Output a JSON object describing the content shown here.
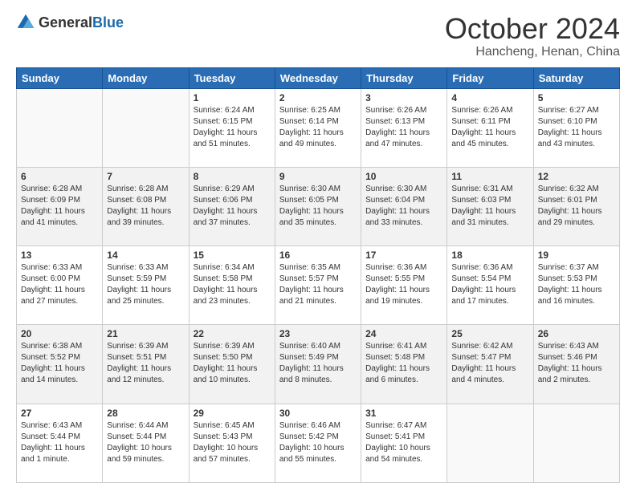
{
  "header": {
    "logo": {
      "general": "General",
      "blue": "Blue"
    },
    "title": "October 2024",
    "location": "Hancheng, Henan, China"
  },
  "weekdays": [
    "Sunday",
    "Monday",
    "Tuesday",
    "Wednesday",
    "Thursday",
    "Friday",
    "Saturday"
  ],
  "weeks": [
    [
      {
        "day": "",
        "sunrise": "",
        "sunset": "",
        "daylight": ""
      },
      {
        "day": "",
        "sunrise": "",
        "sunset": "",
        "daylight": ""
      },
      {
        "day": "1",
        "sunrise": "Sunrise: 6:24 AM",
        "sunset": "Sunset: 6:15 PM",
        "daylight": "Daylight: 11 hours and 51 minutes."
      },
      {
        "day": "2",
        "sunrise": "Sunrise: 6:25 AM",
        "sunset": "Sunset: 6:14 PM",
        "daylight": "Daylight: 11 hours and 49 minutes."
      },
      {
        "day": "3",
        "sunrise": "Sunrise: 6:26 AM",
        "sunset": "Sunset: 6:13 PM",
        "daylight": "Daylight: 11 hours and 47 minutes."
      },
      {
        "day": "4",
        "sunrise": "Sunrise: 6:26 AM",
        "sunset": "Sunset: 6:11 PM",
        "daylight": "Daylight: 11 hours and 45 minutes."
      },
      {
        "day": "5",
        "sunrise": "Sunrise: 6:27 AM",
        "sunset": "Sunset: 6:10 PM",
        "daylight": "Daylight: 11 hours and 43 minutes."
      }
    ],
    [
      {
        "day": "6",
        "sunrise": "Sunrise: 6:28 AM",
        "sunset": "Sunset: 6:09 PM",
        "daylight": "Daylight: 11 hours and 41 minutes."
      },
      {
        "day": "7",
        "sunrise": "Sunrise: 6:28 AM",
        "sunset": "Sunset: 6:08 PM",
        "daylight": "Daylight: 11 hours and 39 minutes."
      },
      {
        "day": "8",
        "sunrise": "Sunrise: 6:29 AM",
        "sunset": "Sunset: 6:06 PM",
        "daylight": "Daylight: 11 hours and 37 minutes."
      },
      {
        "day": "9",
        "sunrise": "Sunrise: 6:30 AM",
        "sunset": "Sunset: 6:05 PM",
        "daylight": "Daylight: 11 hours and 35 minutes."
      },
      {
        "day": "10",
        "sunrise": "Sunrise: 6:30 AM",
        "sunset": "Sunset: 6:04 PM",
        "daylight": "Daylight: 11 hours and 33 minutes."
      },
      {
        "day": "11",
        "sunrise": "Sunrise: 6:31 AM",
        "sunset": "Sunset: 6:03 PM",
        "daylight": "Daylight: 11 hours and 31 minutes."
      },
      {
        "day": "12",
        "sunrise": "Sunrise: 6:32 AM",
        "sunset": "Sunset: 6:01 PM",
        "daylight": "Daylight: 11 hours and 29 minutes."
      }
    ],
    [
      {
        "day": "13",
        "sunrise": "Sunrise: 6:33 AM",
        "sunset": "Sunset: 6:00 PM",
        "daylight": "Daylight: 11 hours and 27 minutes."
      },
      {
        "day": "14",
        "sunrise": "Sunrise: 6:33 AM",
        "sunset": "Sunset: 5:59 PM",
        "daylight": "Daylight: 11 hours and 25 minutes."
      },
      {
        "day": "15",
        "sunrise": "Sunrise: 6:34 AM",
        "sunset": "Sunset: 5:58 PM",
        "daylight": "Daylight: 11 hours and 23 minutes."
      },
      {
        "day": "16",
        "sunrise": "Sunrise: 6:35 AM",
        "sunset": "Sunset: 5:57 PM",
        "daylight": "Daylight: 11 hours and 21 minutes."
      },
      {
        "day": "17",
        "sunrise": "Sunrise: 6:36 AM",
        "sunset": "Sunset: 5:55 PM",
        "daylight": "Daylight: 11 hours and 19 minutes."
      },
      {
        "day": "18",
        "sunrise": "Sunrise: 6:36 AM",
        "sunset": "Sunset: 5:54 PM",
        "daylight": "Daylight: 11 hours and 17 minutes."
      },
      {
        "day": "19",
        "sunrise": "Sunrise: 6:37 AM",
        "sunset": "Sunset: 5:53 PM",
        "daylight": "Daylight: 11 hours and 16 minutes."
      }
    ],
    [
      {
        "day": "20",
        "sunrise": "Sunrise: 6:38 AM",
        "sunset": "Sunset: 5:52 PM",
        "daylight": "Daylight: 11 hours and 14 minutes."
      },
      {
        "day": "21",
        "sunrise": "Sunrise: 6:39 AM",
        "sunset": "Sunset: 5:51 PM",
        "daylight": "Daylight: 11 hours and 12 minutes."
      },
      {
        "day": "22",
        "sunrise": "Sunrise: 6:39 AM",
        "sunset": "Sunset: 5:50 PM",
        "daylight": "Daylight: 11 hours and 10 minutes."
      },
      {
        "day": "23",
        "sunrise": "Sunrise: 6:40 AM",
        "sunset": "Sunset: 5:49 PM",
        "daylight": "Daylight: 11 hours and 8 minutes."
      },
      {
        "day": "24",
        "sunrise": "Sunrise: 6:41 AM",
        "sunset": "Sunset: 5:48 PM",
        "daylight": "Daylight: 11 hours and 6 minutes."
      },
      {
        "day": "25",
        "sunrise": "Sunrise: 6:42 AM",
        "sunset": "Sunset: 5:47 PM",
        "daylight": "Daylight: 11 hours and 4 minutes."
      },
      {
        "day": "26",
        "sunrise": "Sunrise: 6:43 AM",
        "sunset": "Sunset: 5:46 PM",
        "daylight": "Daylight: 11 hours and 2 minutes."
      }
    ],
    [
      {
        "day": "27",
        "sunrise": "Sunrise: 6:43 AM",
        "sunset": "Sunset: 5:44 PM",
        "daylight": "Daylight: 11 hours and 1 minute."
      },
      {
        "day": "28",
        "sunrise": "Sunrise: 6:44 AM",
        "sunset": "Sunset: 5:44 PM",
        "daylight": "Daylight: 10 hours and 59 minutes."
      },
      {
        "day": "29",
        "sunrise": "Sunrise: 6:45 AM",
        "sunset": "Sunset: 5:43 PM",
        "daylight": "Daylight: 10 hours and 57 minutes."
      },
      {
        "day": "30",
        "sunrise": "Sunrise: 6:46 AM",
        "sunset": "Sunset: 5:42 PM",
        "daylight": "Daylight: 10 hours and 55 minutes."
      },
      {
        "day": "31",
        "sunrise": "Sunrise: 6:47 AM",
        "sunset": "Sunset: 5:41 PM",
        "daylight": "Daylight: 10 hours and 54 minutes."
      },
      {
        "day": "",
        "sunrise": "",
        "sunset": "",
        "daylight": ""
      },
      {
        "day": "",
        "sunrise": "",
        "sunset": "",
        "daylight": ""
      }
    ]
  ]
}
